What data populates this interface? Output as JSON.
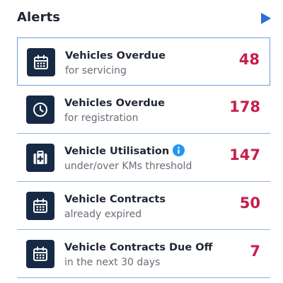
{
  "header": {
    "title": "Alerts",
    "play_icon": "play-triangle-icon",
    "accent_color": "#2f6fd8"
  },
  "colors": {
    "icon_bg": "#172a45",
    "count": "#c51f4a",
    "divider": "#8fb3dc",
    "info": "#2196f3"
  },
  "alerts": [
    {
      "icon": "calendar-icon",
      "title": "Vehicles Overdue",
      "subtitle": "for servicing",
      "count": "48",
      "selected": true,
      "info": false
    },
    {
      "icon": "clock-icon",
      "title": "Vehicles Overdue",
      "subtitle": "for registration",
      "count": "178",
      "selected": false,
      "info": false
    },
    {
      "icon": "first-aid-kit-icon",
      "title": "Vehicle Utilisation",
      "subtitle": "under/over KMs threshold",
      "count": "147",
      "selected": false,
      "info": true
    },
    {
      "icon": "calendar-icon",
      "title": "Vehicle Contracts",
      "subtitle": "already expired",
      "count": "50",
      "selected": false,
      "info": false
    },
    {
      "icon": "calendar-icon",
      "title": "Vehicle Contracts Due Off",
      "subtitle": "in the next 30 days",
      "count": "7",
      "selected": false,
      "info": false
    }
  ]
}
